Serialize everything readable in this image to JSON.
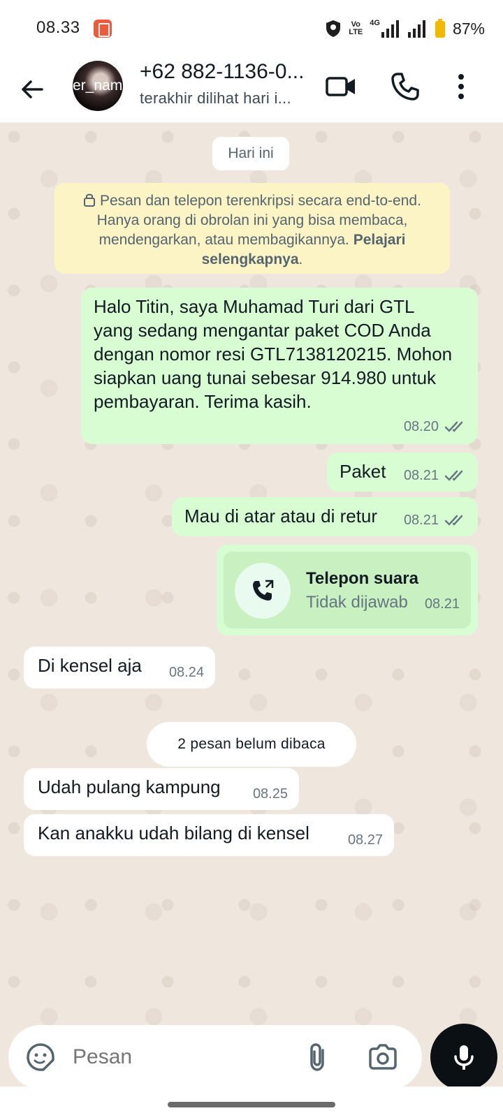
{
  "status_bar": {
    "time": "08.33",
    "battery": "87%",
    "network_labels": [
      "Vo",
      "LTE",
      "4G"
    ]
  },
  "header": {
    "avatar_text": "er_name",
    "contact_name": "+62 882-1136-0...",
    "contact_status": "terakhir dilihat hari i..."
  },
  "chat": {
    "date_chip": "Hari ini",
    "encryption_notice": {
      "text": "Pesan dan telepon terenkripsi secara end-to-end. Hanya orang di obrolan ini yang bisa membaca, mendengarkan, atau membagikannya.",
      "learn_more": "Pelajari selengkapnya",
      "suffix": "."
    },
    "messages": [
      {
        "direction": "out",
        "text": "Halo Titin, saya Muhamad Turi dari GTL yang sedang mengantar paket COD Anda dengan nomor resi GTL7138120215. Mohon siapkan uang tunai sebesar 914.980 untuk pembayaran. Terima kasih.",
        "time": "08.20",
        "status": "read"
      },
      {
        "direction": "out",
        "text": "Paket",
        "time": "08.21",
        "status": "read"
      },
      {
        "direction": "out",
        "text": "Mau di atar atau di retur",
        "time": "08.21",
        "status": "read"
      },
      {
        "direction": "in",
        "text": "Di kensel aja",
        "time": "08.24"
      },
      {
        "direction": "in",
        "text": "Udah pulang kampung",
        "time": "08.25"
      },
      {
        "direction": "in",
        "text": "Kan anakku udah bilang di kensel",
        "time": "08.27"
      }
    ],
    "call": {
      "title": "Telepon suara",
      "subtitle": "Tidak dijawab",
      "time": "08.21"
    },
    "unread_chip": "2 pesan belum dibaca"
  },
  "composer": {
    "placeholder": "Pesan"
  },
  "colors": {
    "outgoing_bubble": "#d9fdd3",
    "incoming_bubble": "#ffffff",
    "chat_background": "#efe7de",
    "encryption_background": "#fdf4c5",
    "read_ticks": "#53bdeb"
  },
  "icons": [
    "back-arrow-icon",
    "video-call-icon",
    "phone-icon",
    "more-vert-icon",
    "lock-icon",
    "double-check-icon",
    "outgoing-call-icon",
    "sticker-icon",
    "attach-icon",
    "camera-icon",
    "mic-icon"
  ]
}
